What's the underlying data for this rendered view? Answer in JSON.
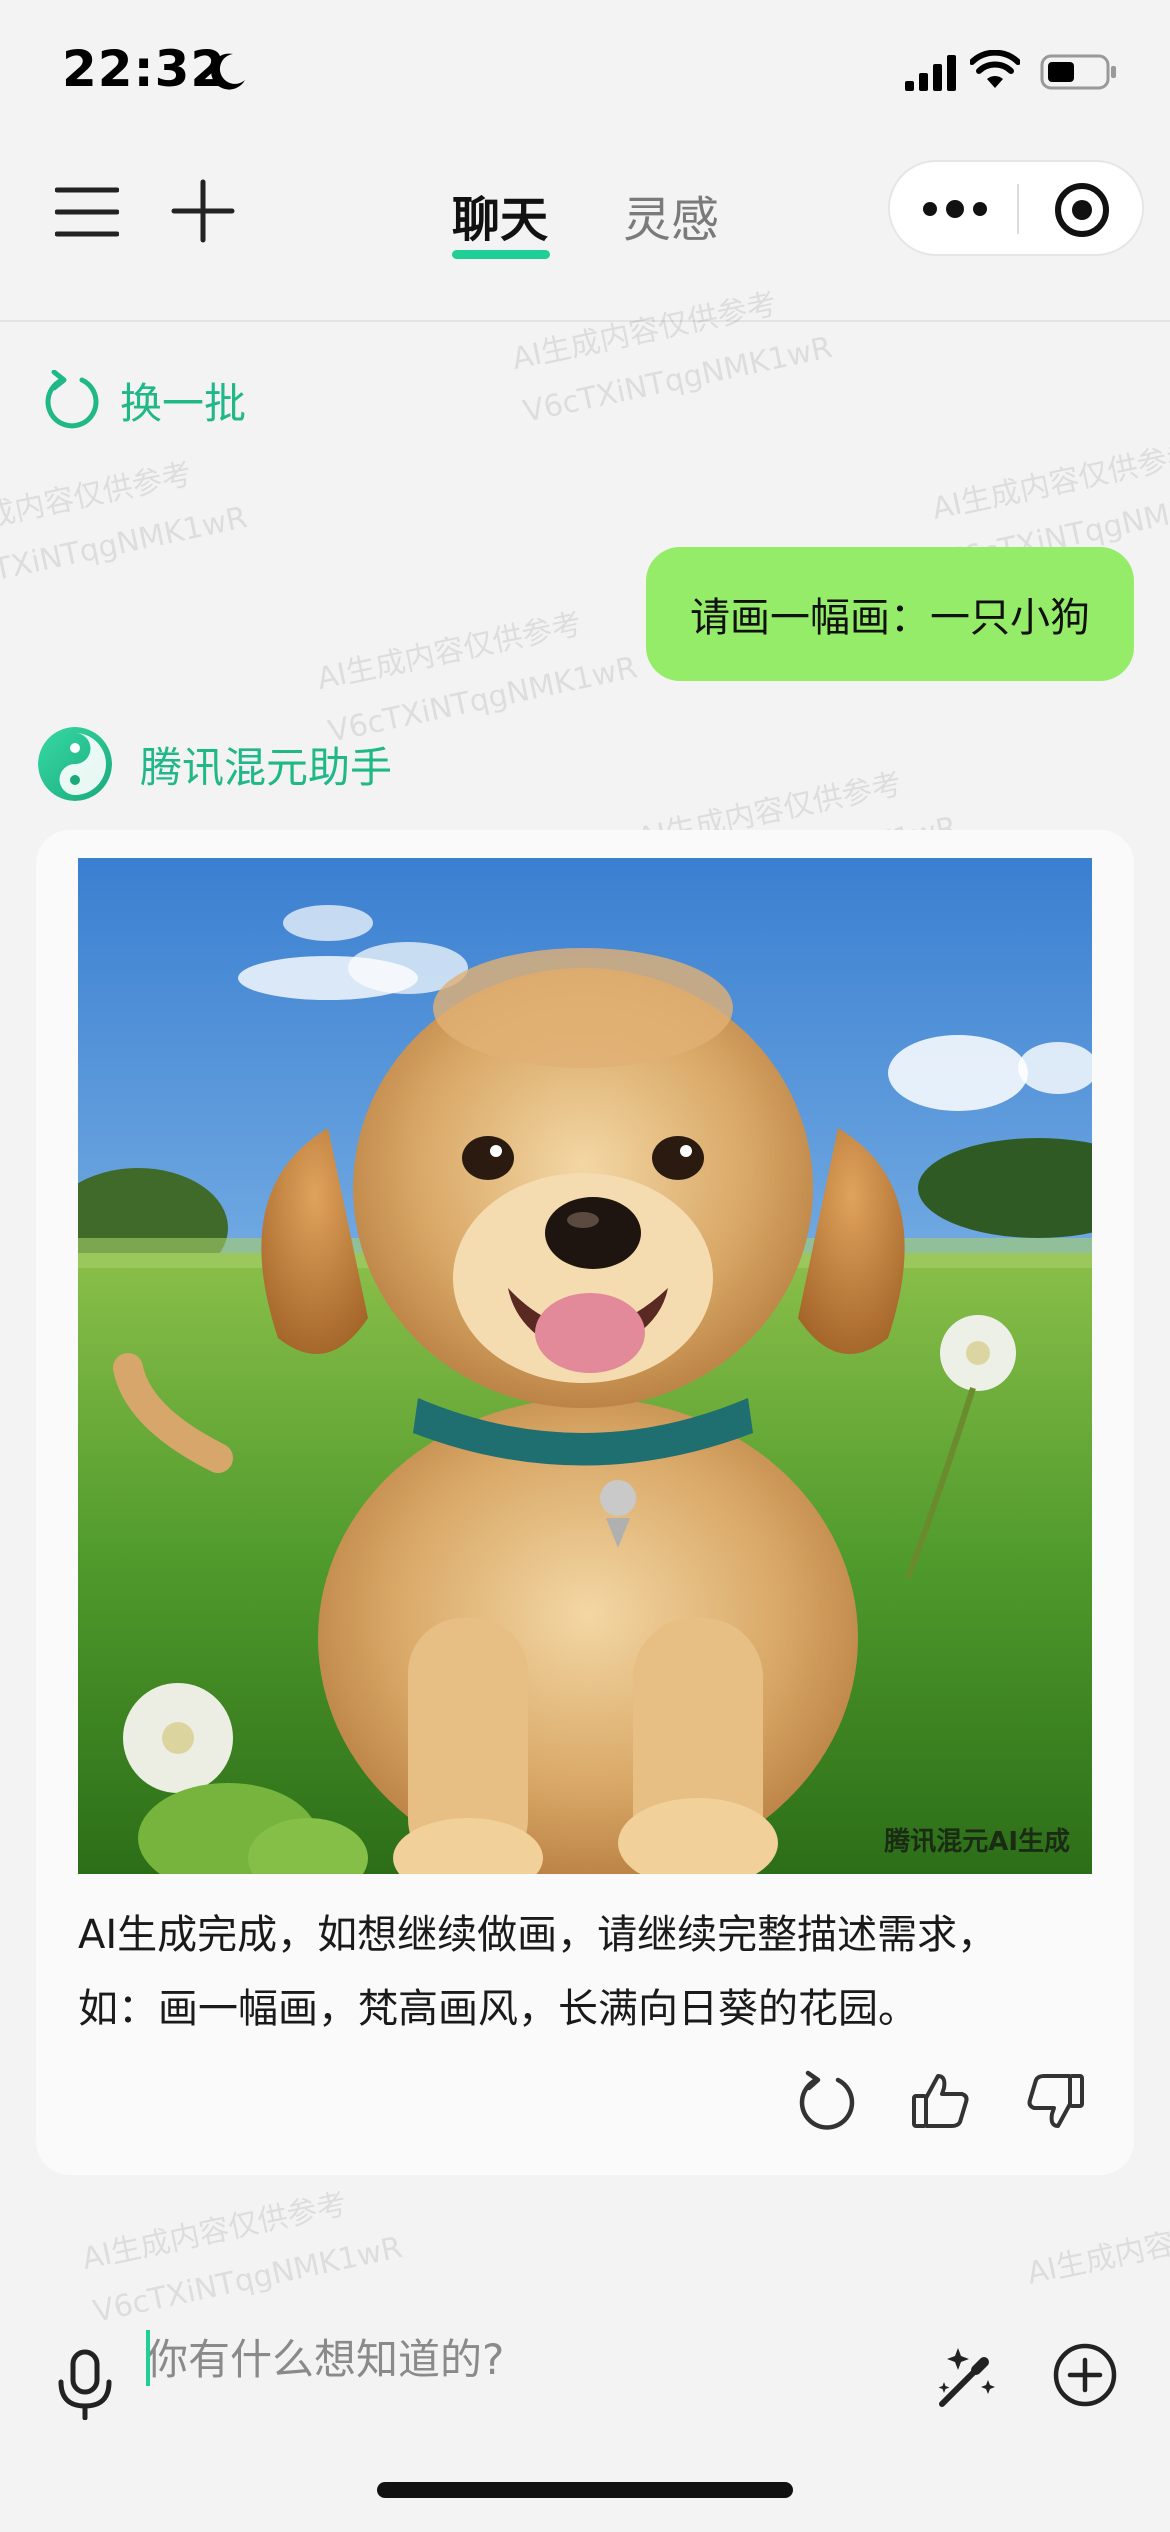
{
  "status_bar": {
    "time": "22:32"
  },
  "topnav": {
    "tabs": [
      {
        "label": "聊天",
        "active": true
      },
      {
        "label": "灵感",
        "active": false
      }
    ]
  },
  "refresh": {
    "label": "换一批"
  },
  "conversation": {
    "user_message": "请画一幅画：一只小狗",
    "assistant": {
      "name": "腾讯混元助手",
      "image_watermark": "腾讯混元AI生成",
      "reply_lines": [
        "AI生成完成，如想继续做画，请继续完整描述需求，",
        "如：画一幅画，梵高画风，长满向日葵的花园。"
      ]
    }
  },
  "watermark": {
    "line1": "AI生成内容仅供参考",
    "line2": "V6cTXiNTqgNMK1wR"
  },
  "input": {
    "placeholder": "你有什么想知道的?"
  },
  "colors": {
    "accent": "#1fcf96",
    "user_bubble": "#95ec69",
    "assistant_name": "#1fb886",
    "background": "#f3f3f3"
  },
  "icons": [
    "moon-icon",
    "signal-icon",
    "wifi-icon",
    "battery-icon",
    "menu-icon",
    "add-icon",
    "more-icon",
    "record-icon",
    "refresh-icon",
    "regenerate-icon",
    "thumbs-up-icon",
    "thumbs-down-icon",
    "mic-icon",
    "magic-wand-icon",
    "plus-circle-icon"
  ]
}
